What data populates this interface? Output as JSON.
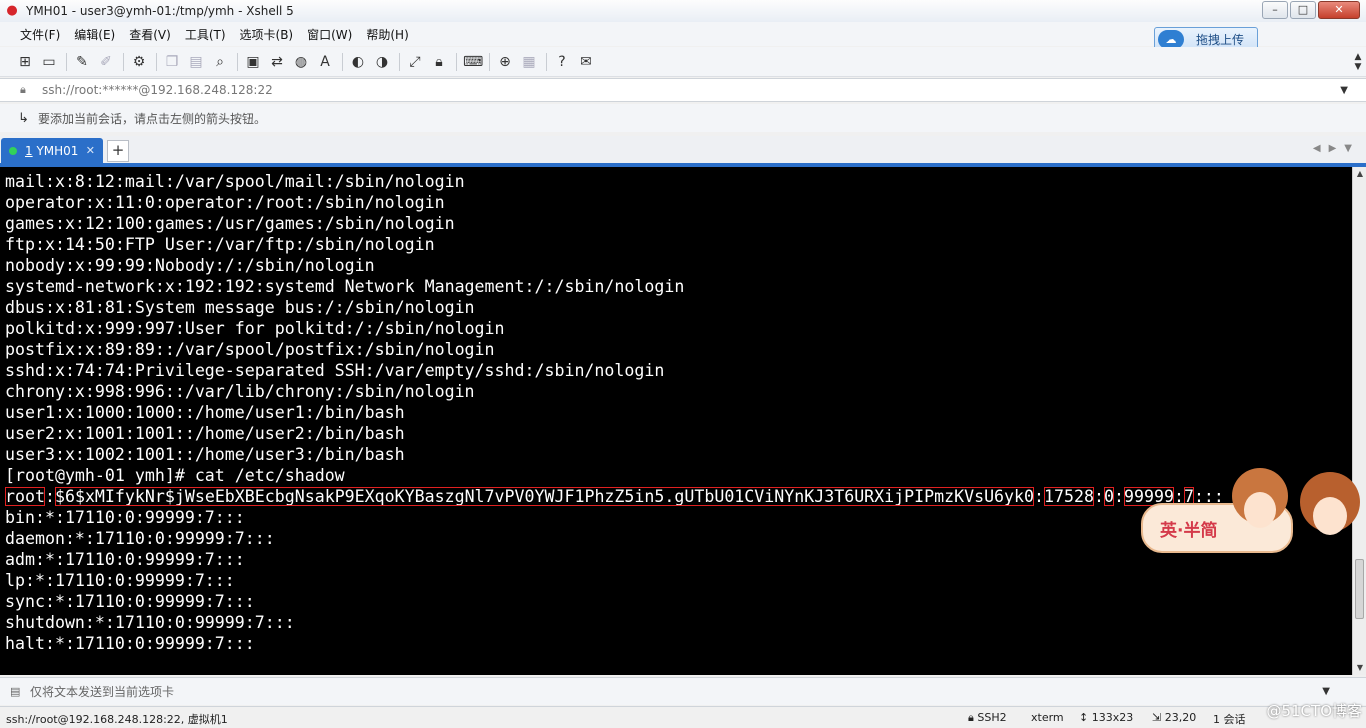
{
  "window": {
    "title": "YMH01 - user3@ymh-01:/tmp/ymh - Xshell 5",
    "app_icon": "xshell-logo-icon",
    "controls": [
      "minimize-icon",
      "maximize-icon",
      "close-icon"
    ]
  },
  "menu": {
    "items": [
      "文件(F)",
      "编辑(E)",
      "查看(V)",
      "工具(T)",
      "选项卡(B)",
      "窗口(W)",
      "帮助(H)"
    ]
  },
  "upload_button": {
    "label": "拖拽上传",
    "icon": "cloud-upload-icon"
  },
  "toolbar": {
    "icons": [
      "new-session-icon",
      "open-folder-icon",
      "connect-icon",
      "disconnect-icon",
      "properties-icon",
      "copy-icon",
      "paste-icon",
      "find-icon",
      "print-icon",
      "transfer-icon",
      "globe-icon",
      "font-icon",
      "xftp-icon",
      "xmanager-icon",
      "fullscreen-icon",
      "lock-icon",
      "keyboard-icon",
      "add-icon",
      "layout-icon",
      "help-icon",
      "chat-icon"
    ]
  },
  "address": {
    "value": "ssh://root:******@192.168.248.128:22",
    "icon": "lock-icon"
  },
  "hint": {
    "text": "要添加当前会话，请点击左侧的箭头按钮。",
    "icon": "add-session-arrow-icon"
  },
  "tabs": {
    "active": {
      "number": "1",
      "label": "YMH01",
      "status_color": "#32d15b"
    },
    "add_label": "+"
  },
  "terminal": {
    "lines": [
      "mail:x:8:12:mail:/var/spool/mail:/sbin/nologin",
      "operator:x:11:0:operator:/root:/sbin/nologin",
      "games:x:12:100:games:/usr/games:/sbin/nologin",
      "ftp:x:14:50:FTP User:/var/ftp:/sbin/nologin",
      "nobody:x:99:99:Nobody:/:/sbin/nologin",
      "systemd-network:x:192:192:systemd Network Management:/:/sbin/nologin",
      "dbus:x:81:81:System message bus:/:/sbin/nologin",
      "polkitd:x:999:997:User for polkitd:/:/sbin/nologin",
      "postfix:x:89:89::/var/spool/postfix:/sbin/nologin",
      "sshd:x:74:74:Privilege-separated SSH:/var/empty/sshd:/sbin/nologin",
      "chrony:x:998:996::/var/lib/chrony:/sbin/nologin",
      "user1:x:1000:1000::/home/user1:/bin/bash",
      "user2:x:1001:1001::/home/user2:/bin/bash",
      "user3:x:1002:1001::/home/user3:/bin/bash",
      "[root@ymh-01 ymh]# cat /etc/shadow"
    ],
    "shadow_root": {
      "user": "root",
      "hash": "$6$xMIfykNr$jWseEbXBEcbgNsakP9EXqoKYBaszgNl7vPV0YWJF1PhzZ5in5.gUTbU01CViNYnKJ3T6URXijPIPmzKVsU6yk0",
      "last_change": "17528",
      "min": "0",
      "max": "99999",
      "warn": "7",
      "rest": ":::"
    },
    "after_lines": [
      "bin:*:17110:0:99999:7:::",
      "daemon:*:17110:0:99999:7:::",
      "adm:*:17110:0:99999:7:::",
      "lp:*:17110:0:99999:7:::",
      "sync:*:17110:0:99999:7:::",
      "shutdown:*:17110:0:99999:7:::",
      "halt:*:17110:0:99999:7:::"
    ],
    "highlight_color": "#e02020",
    "scroll_fraction": 0.9
  },
  "mascot": {
    "text": "英·半简"
  },
  "compose": {
    "placeholder": "仅将文本发送到当前选项卡"
  },
  "status": {
    "connection": "ssh://root@192.168.248.128:22, 虚拟机1",
    "protocol": "SSH2",
    "terminal_type": "xterm",
    "size": "133x23",
    "cursor": "23,20",
    "sessions": "1 会话"
  },
  "watermark": "@51CTO博客"
}
